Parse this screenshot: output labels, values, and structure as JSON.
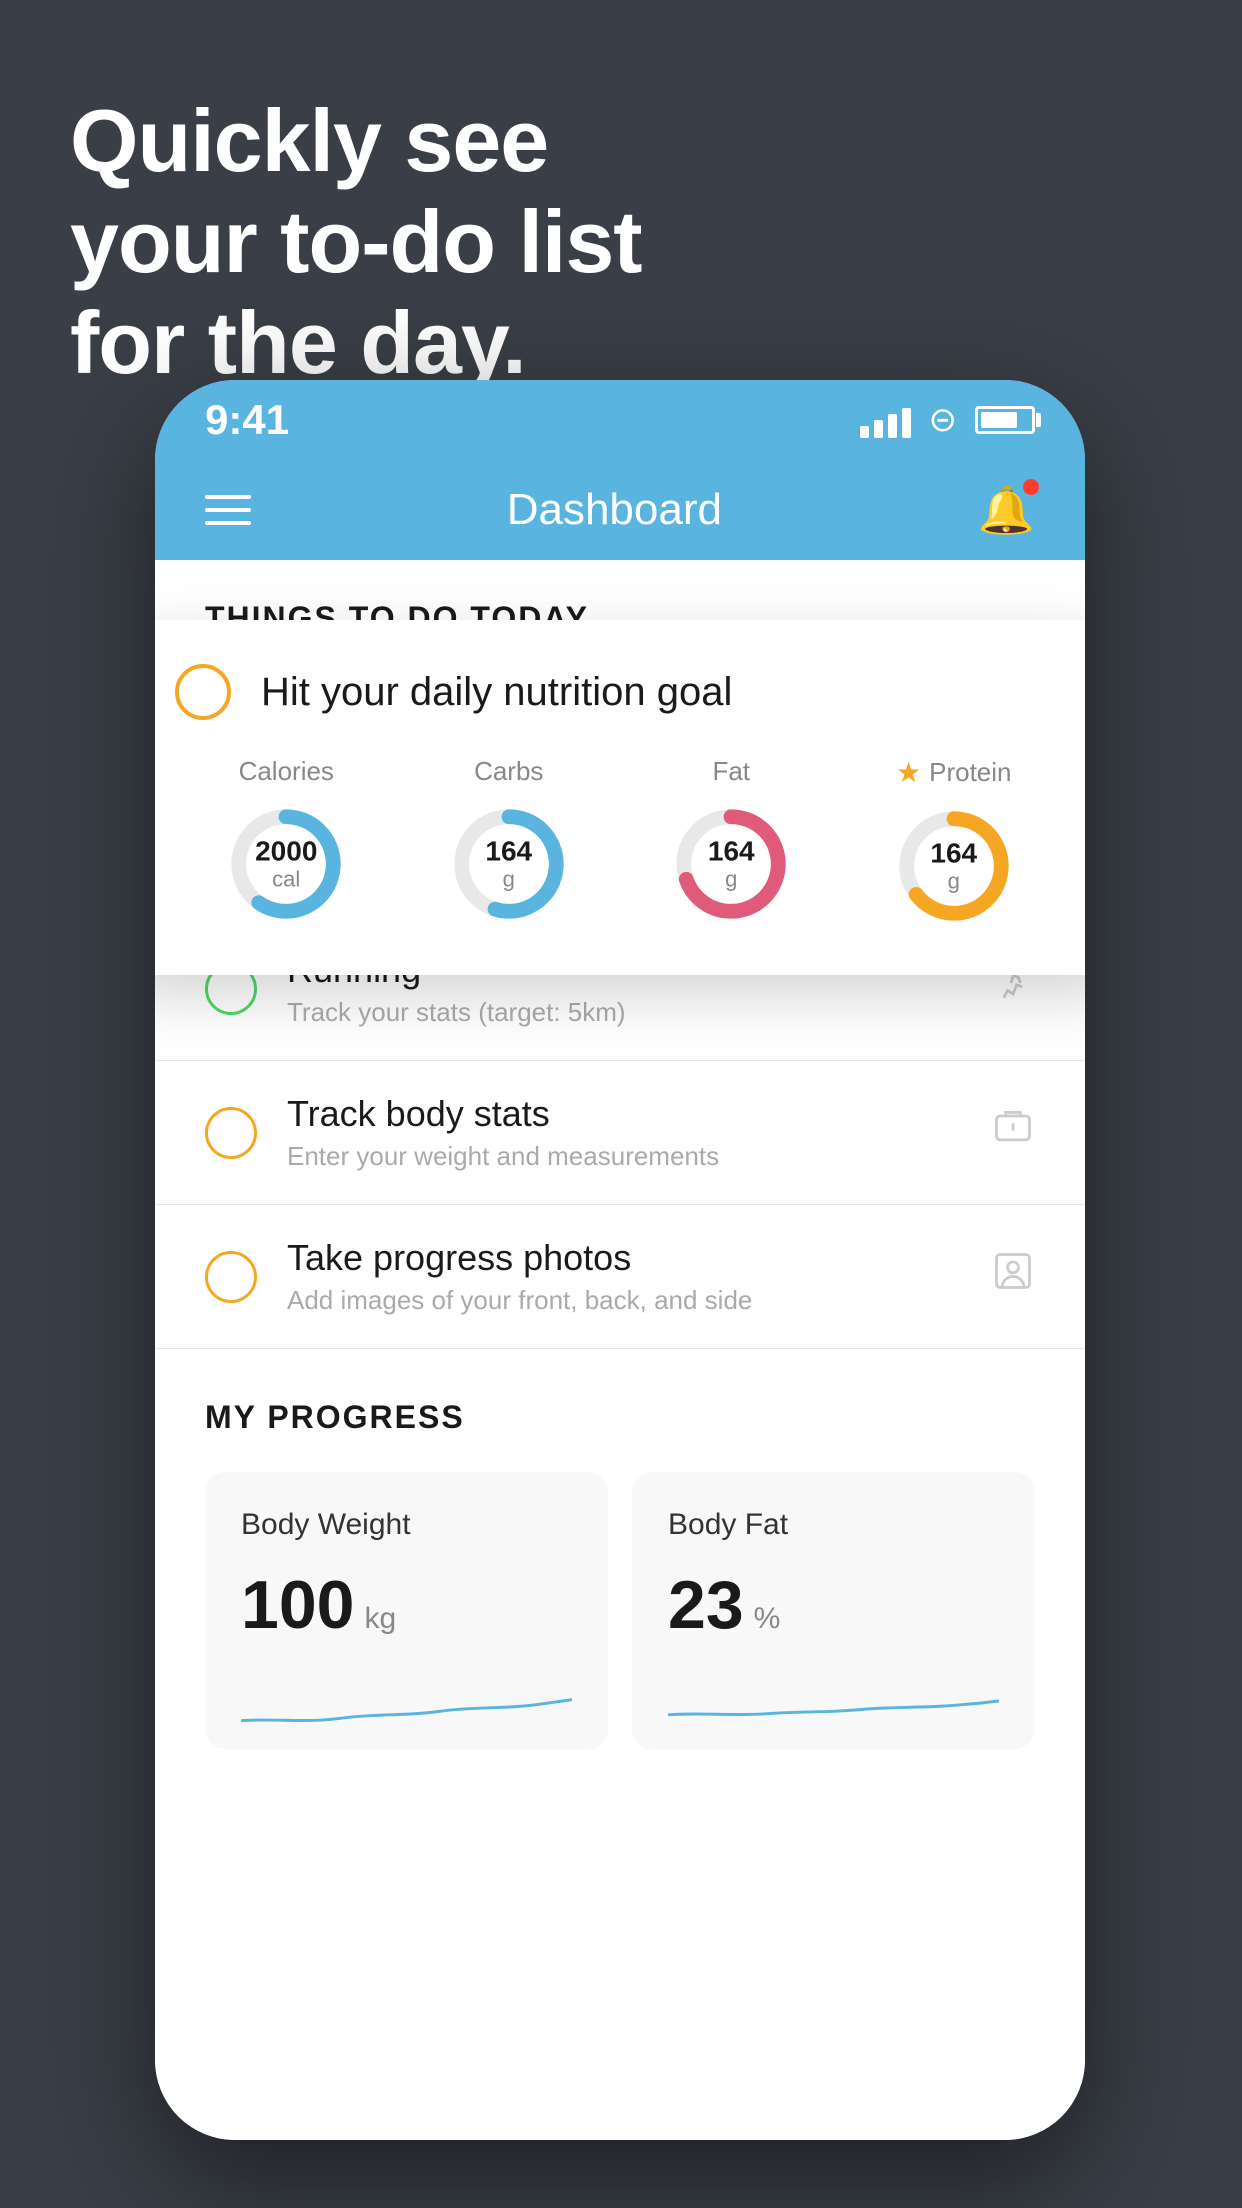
{
  "background": {
    "headline_line1": "Quickly see",
    "headline_line2": "your to-do list",
    "headline_line3": "for the day."
  },
  "statusBar": {
    "time": "9:41",
    "signal_bars": [
      12,
      18,
      24,
      30
    ],
    "battery_pct": 75
  },
  "navBar": {
    "title": "Dashboard"
  },
  "thingsSection": {
    "header": "THINGS TO DO TODAY"
  },
  "floatingCard": {
    "title": "Hit your daily nutrition goal",
    "nutrition": [
      {
        "label": "Calories",
        "value": "2000",
        "unit": "cal",
        "color": "#5ab4e0",
        "pct": 60,
        "star": false
      },
      {
        "label": "Carbs",
        "value": "164",
        "unit": "g",
        "color": "#5ab4e0",
        "pct": 55,
        "star": false
      },
      {
        "label": "Fat",
        "value": "164",
        "unit": "g",
        "color": "#e05a7a",
        "pct": 70,
        "star": false
      },
      {
        "label": "Protein",
        "value": "164",
        "unit": "g",
        "color": "#f5a623",
        "pct": 65,
        "star": true
      }
    ]
  },
  "todoItems": [
    {
      "id": "running",
      "title": "Running",
      "subtitle": "Track your stats (target: 5km)",
      "circle": "green",
      "icon": "👟"
    },
    {
      "id": "body-stats",
      "title": "Track body stats",
      "subtitle": "Enter your weight and measurements",
      "circle": "yellow",
      "icon": "⚖"
    },
    {
      "id": "photos",
      "title": "Take progress photos",
      "subtitle": "Add images of your front, back, and side",
      "circle": "yellow",
      "icon": "👤"
    }
  ],
  "progressSection": {
    "header": "MY PROGRESS",
    "cards": [
      {
        "title": "Body Weight",
        "value": "100",
        "unit": "kg"
      },
      {
        "title": "Body Fat",
        "value": "23",
        "unit": "%"
      }
    ]
  }
}
